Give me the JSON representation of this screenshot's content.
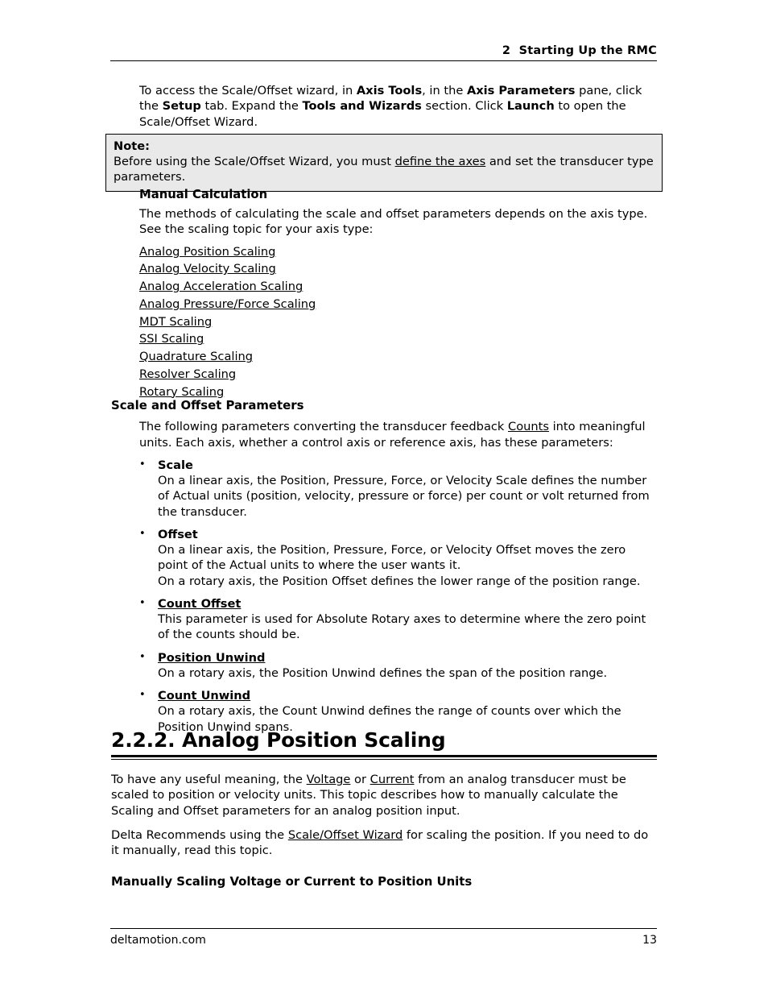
{
  "header": {
    "title": "2  Starting Up the RMC"
  },
  "intro": {
    "line_a": "To access the Scale/Offset wizard, in ",
    "bold_1": "Axis Tools",
    "line_b": ", in the ",
    "bold_2": "Axis Parameters",
    "line_c": " pane, click the ",
    "bold_3": "Setup",
    "line_d": " tab. Expand the ",
    "bold_4": "Tools and Wizards",
    "line_e": " section. Click ",
    "bold_5": "Launch",
    "line_f": " to open the Scale/Offset Wizard."
  },
  "note": {
    "label": "Note:",
    "text_a": "Before using the Scale/Offset Wizard, you must ",
    "link": "define the axes",
    "text_b": " and set the transducer type parameters."
  },
  "manual_calculation": {
    "heading": "Manual Calculation",
    "paragraph": "The methods of calculating the scale and offset parameters depends on the axis type. See the scaling topic for your axis type:",
    "links": [
      "Analog Position Scaling",
      "Analog Velocity Scaling",
      "Analog Acceleration Scaling",
      "Analog Pressure/Force Scaling",
      "MDT Scaling",
      "SSI Scaling",
      "Quadrature Scaling",
      "Resolver Scaling",
      "Rotary Scaling"
    ]
  },
  "scale_offset_parameters": {
    "heading": "Scale and Offset Parameters",
    "intro_a": "The following parameters converting the transducer feedback ",
    "intro_link": "Counts",
    "intro_b": " into meaningful units. Each axis, whether a control axis or reference axis, has these parameters:",
    "bullet_glyph": "•",
    "items": [
      {
        "term": "Scale",
        "term_linked": false,
        "body": "On a linear axis, the Position, Pressure, Force, or Velocity Scale defines the number of Actual units (position, velocity, pressure or force) per count or volt returned from the transducer."
      },
      {
        "term": "Offset",
        "term_linked": false,
        "body": "On a linear axis, the Position, Pressure, Force, or Velocity Offset moves the zero point of the Actual units to where the user wants it.",
        "body2": "On a rotary axis, the Position Offset defines the lower range of the position range."
      },
      {
        "term": "Count Offset",
        "term_linked": true,
        "body": "This parameter is used for Absolute Rotary axes to determine where the zero point of the counts should be."
      },
      {
        "term": "Position Unwind",
        "term_linked": true,
        "body": "On a rotary axis, the Position Unwind defines the span of the position range."
      },
      {
        "term": "Count Unwind",
        "term_linked": true,
        "body": "On a rotary axis, the Count Unwind defines the range of counts over which the Position Unwind spans."
      }
    ]
  },
  "chapter": {
    "title": "2.2.2. Analog Position Scaling"
  },
  "analog_position_scaling": {
    "p1_a": "To have any useful meaning, the ",
    "p1_link1": "Voltage",
    "p1_b": " or ",
    "p1_link2": "Current",
    "p1_c": " from an analog transducer must be scaled to position or velocity units. This topic describes how to manually calculate the Scaling and Offset parameters for an analog position input.",
    "p2_a": "Delta Recommends using the ",
    "p2_link": "Scale/Offset Wizard",
    "p2_b": " for scaling the position. If you need to do it manually, read this topic.",
    "subheading": "Manually Scaling Voltage or Current to Position Units"
  },
  "footer": {
    "site": "deltamotion.com",
    "page_number": "13"
  }
}
